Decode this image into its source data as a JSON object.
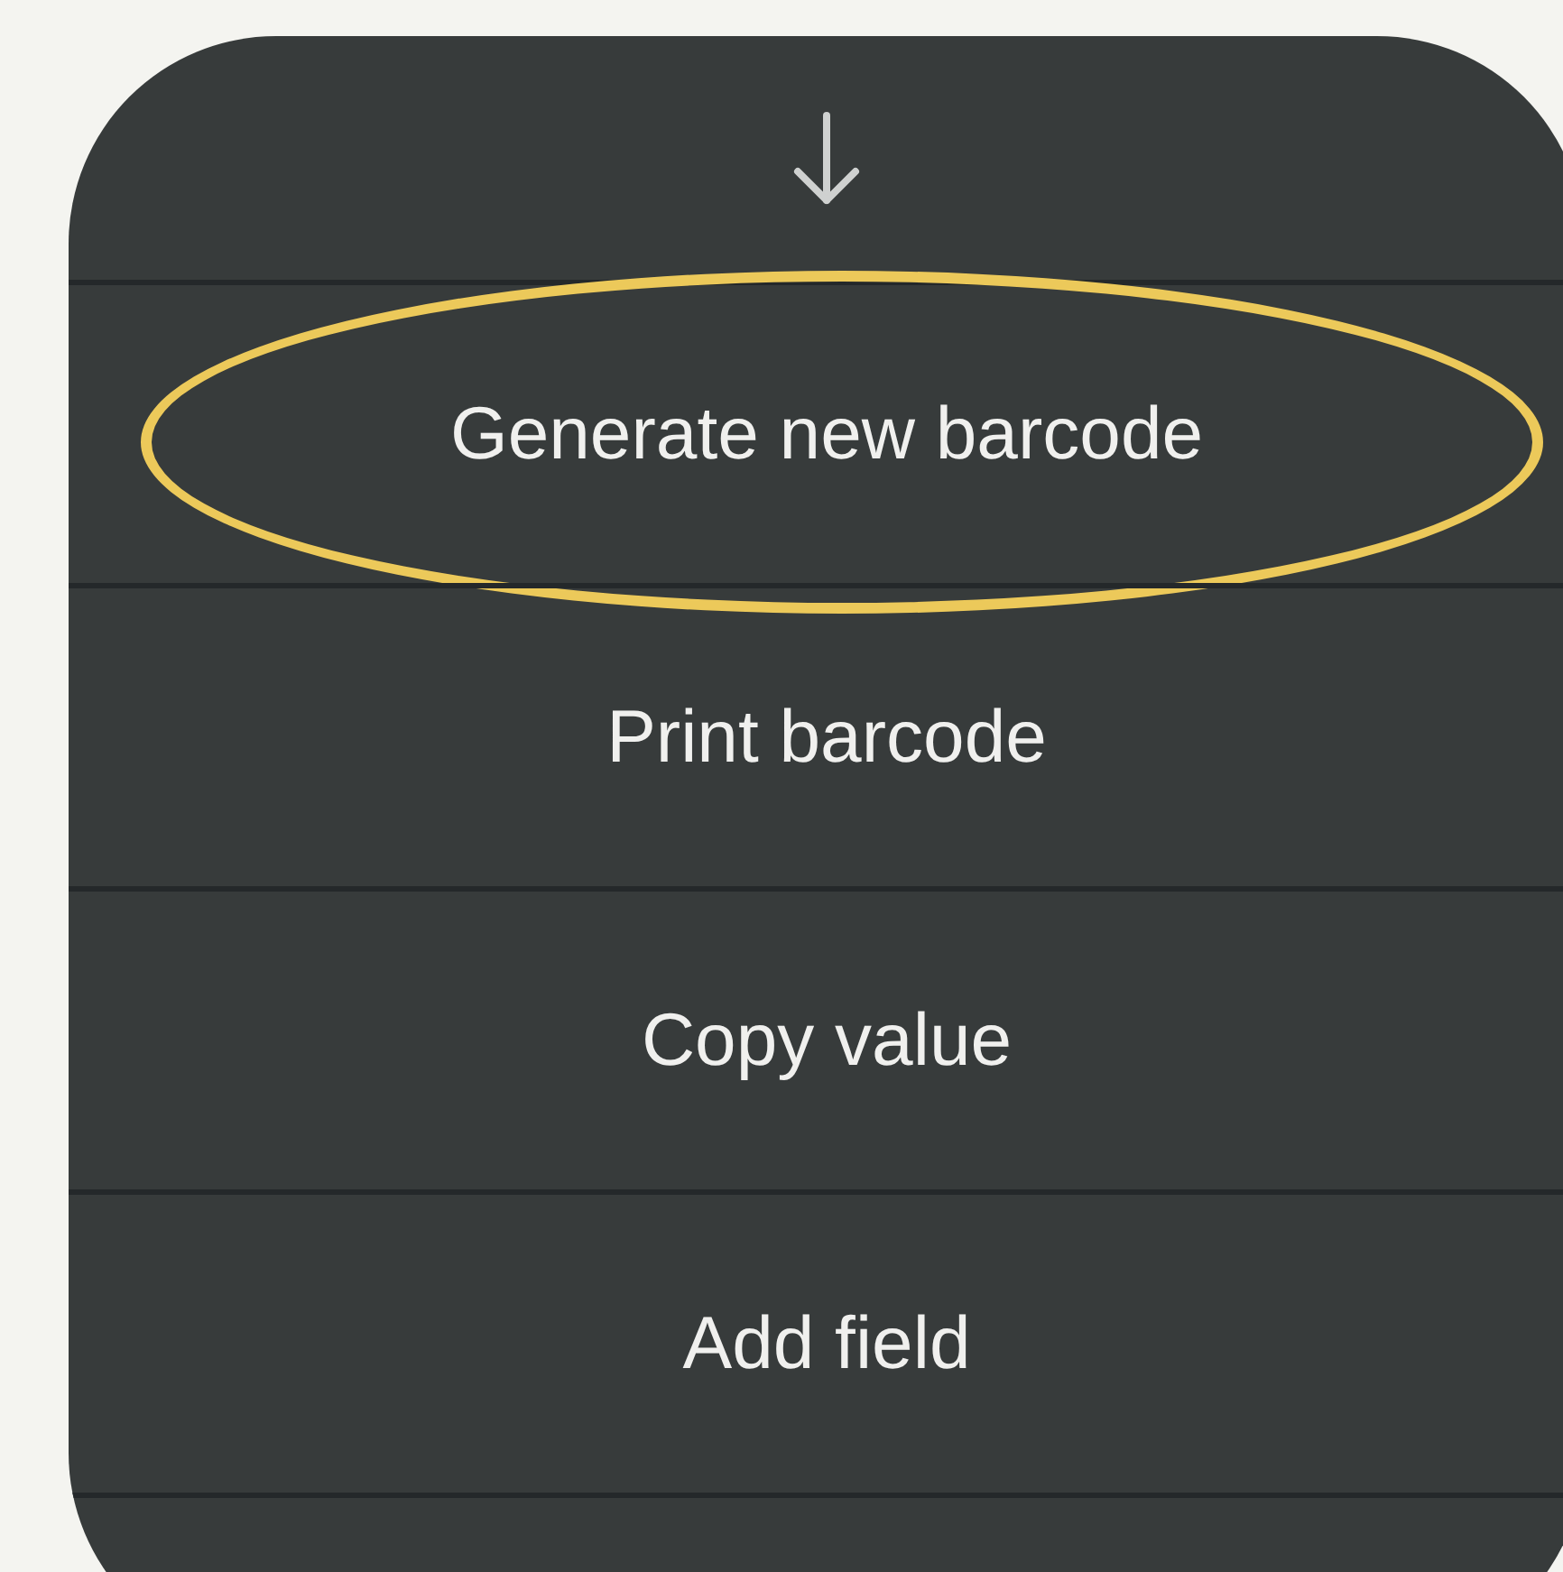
{
  "menu": {
    "items": [
      {
        "label": "Generate new barcode",
        "highlighted": true
      },
      {
        "label": "Print barcode",
        "highlighted": false
      },
      {
        "label": "Copy value",
        "highlighted": false
      },
      {
        "label": "Add field",
        "highlighted": false
      }
    ]
  }
}
